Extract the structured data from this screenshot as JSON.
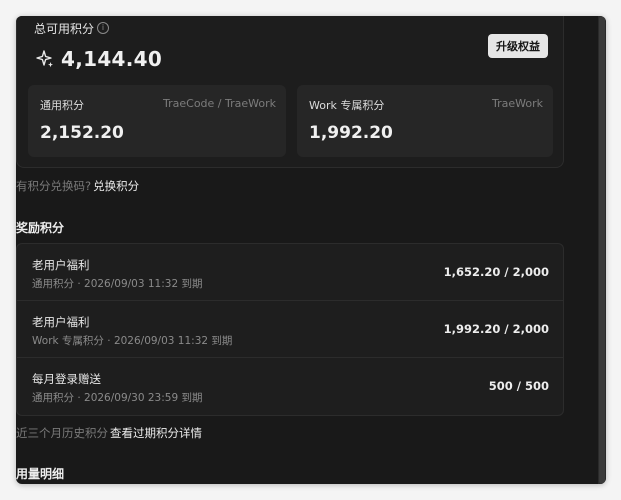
{
  "points": {
    "total_label": "总可用积分",
    "info_symbol": "i",
    "total_value": "4,144.40",
    "upgrade_button": "升级权益",
    "general": {
      "label": "通用积分",
      "scope": "TraeCode / TraeWork",
      "value": "2,152.20"
    },
    "work": {
      "label": "Work 专属积分",
      "scope": "TraeWork",
      "value": "1,992.20"
    }
  },
  "redeem": {
    "prompt": "有积分兑换码?",
    "link": "兑换积分"
  },
  "rewards": {
    "title": "奖励积分",
    "items": [
      {
        "name": "老用户福利",
        "meta": "通用积分 · 2026/09/03 11:32 到期",
        "amount": "1,652.20 / 2,000"
      },
      {
        "name": "老用户福利",
        "meta": "Work 专属积分 · 2026/09/03 11:32 到期",
        "amount": "1,992.20 / 2,000"
      },
      {
        "name": "每月登录赠送",
        "meta": "通用积分 · 2026/09/30 23:59 到期",
        "amount": "500 / 500"
      }
    ]
  },
  "history": {
    "prompt": "近三个月历史积分",
    "link": "查看过期积分详情"
  },
  "usage": {
    "title": "用量明细"
  },
  "colors": {
    "background": "#191919",
    "card": "#1d1d1d",
    "sub_card": "#262626",
    "button": "#e6e6e6"
  }
}
